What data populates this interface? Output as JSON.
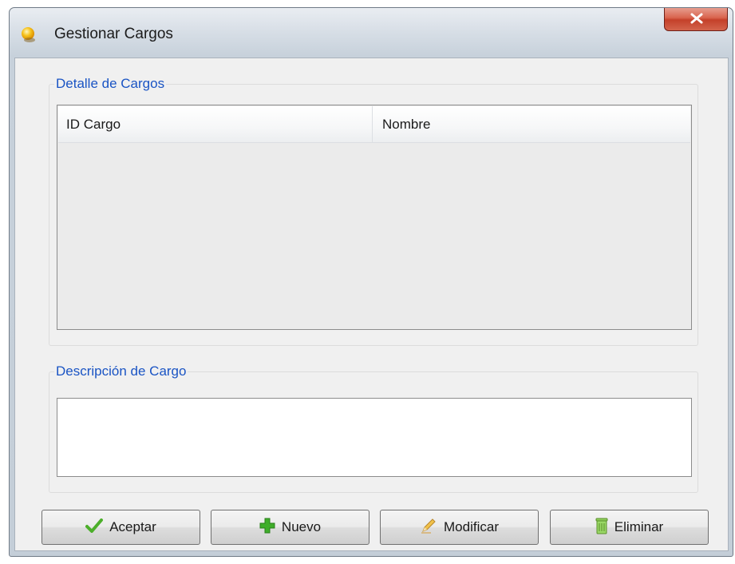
{
  "window": {
    "title": "Gestionar Cargos",
    "icon": "app-bulb-icon",
    "close_icon": "close-icon"
  },
  "detalle": {
    "legend": "Detalle de Cargos",
    "columns": [
      "ID Cargo",
      "Nombre"
    ],
    "rows": []
  },
  "descripcion": {
    "legend": "Descripción de Cargo",
    "value": ""
  },
  "buttons": {
    "aceptar": {
      "label": "Aceptar",
      "icon": "checkmark-icon"
    },
    "nuevo": {
      "label": "Nuevo",
      "icon": "plus-icon"
    },
    "modificar": {
      "label": "Modificar",
      "icon": "pencil-icon"
    },
    "eliminar": {
      "label": "Eliminar",
      "icon": "trash-icon"
    }
  },
  "colors": {
    "legend_text": "#1a54c4",
    "close_button": "#c4412a",
    "check_green": "#4caf2a",
    "plus_green": "#3fae2a"
  }
}
